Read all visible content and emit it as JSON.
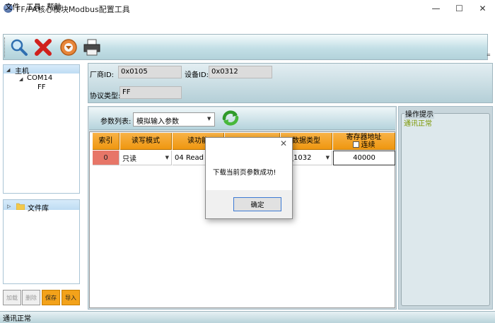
{
  "window": {
    "title": "FF/PA核心模块Modbus配置工具",
    "controls": {
      "minimize": "—",
      "maximize": "☐",
      "close": "✕"
    }
  },
  "menu": {
    "file": "文件",
    "tools": "工具",
    "help": "帮助"
  },
  "toolbar": {
    "icons": [
      "search-icon",
      "delete-icon",
      "download-icon",
      "print-icon"
    ],
    "overflow": "="
  },
  "tree": {
    "root": "主机",
    "port": "COM14",
    "device": "FF",
    "library": "文件库"
  },
  "left_buttons": {
    "load": "加载",
    "delete": "删除",
    "save": "保存",
    "import": "导入"
  },
  "info": {
    "vendor_label": "厂商ID:",
    "vendor_value": "0x0105",
    "device_label": "设备ID:",
    "device_value": "0x0312",
    "protocol_label": "协议类型:",
    "protocol_value": "FF"
  },
  "params": {
    "label": "参数列表:",
    "selected": "模拟输入参数"
  },
  "table": {
    "headers": [
      "索引",
      "读写模式",
      "读功能",
      "",
      "数据类型",
      "寄存器地址"
    ],
    "addr_checkbox_label": "连续",
    "row": {
      "index": "0",
      "mode": "只读",
      "func": "04 Read I",
      "col4": "",
      "type": "at_1032",
      "addr": "40000"
    }
  },
  "hint": {
    "title": "操作提示",
    "text": "通讯正常"
  },
  "status": {
    "text": "通讯正常"
  },
  "dialog": {
    "message": "下载当前页参数成功!",
    "ok": "确定",
    "close": "✕"
  },
  "colors": {
    "accent_orange": "#ef9710",
    "index_cell": "#e77668",
    "hint_text": "#7b9600"
  }
}
